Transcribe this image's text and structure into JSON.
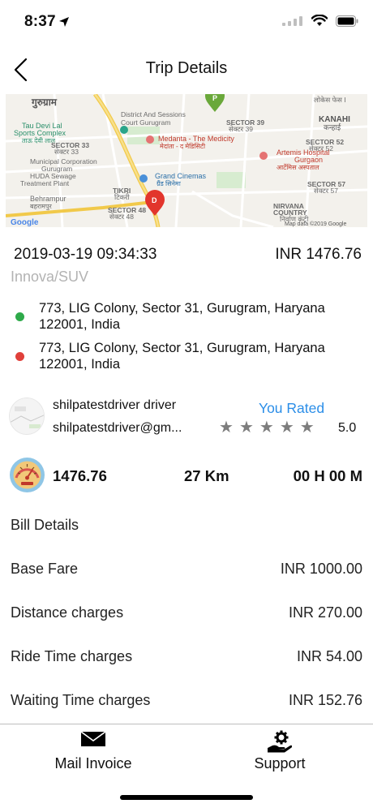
{
  "status_bar": {
    "time": "8:37",
    "location_icon": "location-arrow-icon",
    "wifi_icon": "wifi-icon",
    "battery_icon": "battery-icon"
  },
  "nav": {
    "title": "Trip Details",
    "back_icon": "chevron-left-icon"
  },
  "map": {
    "labels": {
      "gurugram_hi": "गुरुग्राम",
      "courts": "District And Sessions",
      "courts2": "Court Gurugram",
      "sector39": "SECTOR 39",
      "sector39_hi": "सेक्टर 39",
      "kanahi": "KANAHI",
      "kanahi_hi": "कन्हाई",
      "taudevilal": "Tau Devi Lal",
      "taudevilal2": "Sports Complex",
      "taudevilal_hi": "ताऊ देवी लाल",
      "medanta": "Medanta - The Medicity",
      "medanta_hi": "मेदांता - द मेडिसिटी",
      "sector52": "SECTOR 52",
      "sector52_hi": "सेक्टर 52",
      "sector33": "SECTOR 33",
      "sector33_hi": "सेक्टर 33",
      "artemis": "Artemis Hospital",
      "artemis2": "Gurgaon",
      "artemis_hi": "आर्टेमिस अस्पताल",
      "municipal": "Municipal Corporation",
      "municipal2": "Gurugram",
      "huda": "HUDA Sewage",
      "huda2": "Treatment Plant",
      "grand": "Grand Cinemas",
      "grand_hi": "ग्रैंड सिनेमा",
      "sector57": "SECTOR 57",
      "sector57_hi": "सेक्टर 57",
      "tikri": "TIKRI",
      "tikri_hi": "टिकरी",
      "behrampur": "Behrampur",
      "behrampur_hi": "बहरामपुर",
      "sector48": "SECTOR 48",
      "sector48_hi": "सेक्टर 48",
      "nirvana": "NIRVANA",
      "nirvana2": "COUNTRY",
      "nirvana_hi": "निर्वाण कंट्री",
      "lokes": "लोकेस फेस I",
      "google": "Google",
      "mapdata": "Map data ©2019 Google",
      "pin_pickup": "P",
      "pin_drop": "D"
    },
    "colors": {
      "land": "#f3f1ec",
      "major_road": "#f6d66a",
      "road": "#ffffff",
      "park": "#cde9c4",
      "pickup_pin": "#6aa83a",
      "drop_pin": "#e2352c"
    }
  },
  "trip": {
    "datetime": "2019-03-19 09:34:33",
    "amount": "INR 1476.76",
    "vehicle": "Innova/SUV",
    "pickup_address": "773, LIG Colony, Sector 31, Gurugram, Haryana 122001, India",
    "drop_address": "773, LIG Colony, Sector 31, Gurugram, Haryana 122001, India",
    "pickup_color": "#2eaa4a",
    "drop_color": "#e0403a"
  },
  "driver": {
    "name": "shilpatestdriver driver",
    "email": "shilpatestdriver@gm...",
    "rated_label": "You Rated",
    "rating": "5.0",
    "stars": 5,
    "star_glyph": "★"
  },
  "stats": {
    "icon": "speedometer-icon",
    "amount": "1476.76",
    "distance": "27 Km",
    "duration": "00 H 00 M"
  },
  "bill": {
    "title": "Bill Details",
    "rows": [
      {
        "label": "Base Fare",
        "value": "INR 1000.00"
      },
      {
        "label": "Distance charges",
        "value": "INR 270.00"
      },
      {
        "label": "Ride Time charges",
        "value": "INR 54.00"
      },
      {
        "label": "Waiting Time charges",
        "value": "INR 152.76"
      }
    ]
  },
  "actions": {
    "mail_label": "Mail Invoice",
    "mail_icon": "envelope-icon",
    "support_label": "Support",
    "support_icon": "support-gear-hand-icon"
  }
}
